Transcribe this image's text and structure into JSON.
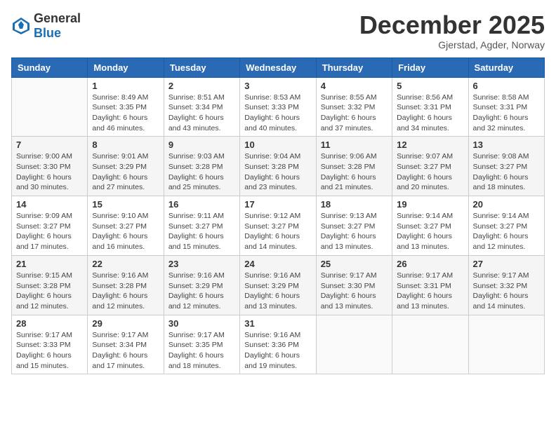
{
  "logo": {
    "text_general": "General",
    "text_blue": "Blue"
  },
  "header": {
    "month": "December 2025",
    "location": "Gjerstad, Agder, Norway"
  },
  "days_of_week": [
    "Sunday",
    "Monday",
    "Tuesday",
    "Wednesday",
    "Thursday",
    "Friday",
    "Saturday"
  ],
  "weeks": [
    [
      {
        "day": "",
        "sunrise": "",
        "sunset": "",
        "daylight": ""
      },
      {
        "day": "1",
        "sunrise": "Sunrise: 8:49 AM",
        "sunset": "Sunset: 3:35 PM",
        "daylight": "Daylight: 6 hours and 46 minutes."
      },
      {
        "day": "2",
        "sunrise": "Sunrise: 8:51 AM",
        "sunset": "Sunset: 3:34 PM",
        "daylight": "Daylight: 6 hours and 43 minutes."
      },
      {
        "day": "3",
        "sunrise": "Sunrise: 8:53 AM",
        "sunset": "Sunset: 3:33 PM",
        "daylight": "Daylight: 6 hours and 40 minutes."
      },
      {
        "day": "4",
        "sunrise": "Sunrise: 8:55 AM",
        "sunset": "Sunset: 3:32 PM",
        "daylight": "Daylight: 6 hours and 37 minutes."
      },
      {
        "day": "5",
        "sunrise": "Sunrise: 8:56 AM",
        "sunset": "Sunset: 3:31 PM",
        "daylight": "Daylight: 6 hours and 34 minutes."
      },
      {
        "day": "6",
        "sunrise": "Sunrise: 8:58 AM",
        "sunset": "Sunset: 3:31 PM",
        "daylight": "Daylight: 6 hours and 32 minutes."
      }
    ],
    [
      {
        "day": "7",
        "sunrise": "Sunrise: 9:00 AM",
        "sunset": "Sunset: 3:30 PM",
        "daylight": "Daylight: 6 hours and 30 minutes."
      },
      {
        "day": "8",
        "sunrise": "Sunrise: 9:01 AM",
        "sunset": "Sunset: 3:29 PM",
        "daylight": "Daylight: 6 hours and 27 minutes."
      },
      {
        "day": "9",
        "sunrise": "Sunrise: 9:03 AM",
        "sunset": "Sunset: 3:28 PM",
        "daylight": "Daylight: 6 hours and 25 minutes."
      },
      {
        "day": "10",
        "sunrise": "Sunrise: 9:04 AM",
        "sunset": "Sunset: 3:28 PM",
        "daylight": "Daylight: 6 hours and 23 minutes."
      },
      {
        "day": "11",
        "sunrise": "Sunrise: 9:06 AM",
        "sunset": "Sunset: 3:28 PM",
        "daylight": "Daylight: 6 hours and 21 minutes."
      },
      {
        "day": "12",
        "sunrise": "Sunrise: 9:07 AM",
        "sunset": "Sunset: 3:27 PM",
        "daylight": "Daylight: 6 hours and 20 minutes."
      },
      {
        "day": "13",
        "sunrise": "Sunrise: 9:08 AM",
        "sunset": "Sunset: 3:27 PM",
        "daylight": "Daylight: 6 hours and 18 minutes."
      }
    ],
    [
      {
        "day": "14",
        "sunrise": "Sunrise: 9:09 AM",
        "sunset": "Sunset: 3:27 PM",
        "daylight": "Daylight: 6 hours and 17 minutes."
      },
      {
        "day": "15",
        "sunrise": "Sunrise: 9:10 AM",
        "sunset": "Sunset: 3:27 PM",
        "daylight": "Daylight: 6 hours and 16 minutes."
      },
      {
        "day": "16",
        "sunrise": "Sunrise: 9:11 AM",
        "sunset": "Sunset: 3:27 PM",
        "daylight": "Daylight: 6 hours and 15 minutes."
      },
      {
        "day": "17",
        "sunrise": "Sunrise: 9:12 AM",
        "sunset": "Sunset: 3:27 PM",
        "daylight": "Daylight: 6 hours and 14 minutes."
      },
      {
        "day": "18",
        "sunrise": "Sunrise: 9:13 AM",
        "sunset": "Sunset: 3:27 PM",
        "daylight": "Daylight: 6 hours and 13 minutes."
      },
      {
        "day": "19",
        "sunrise": "Sunrise: 9:14 AM",
        "sunset": "Sunset: 3:27 PM",
        "daylight": "Daylight: 6 hours and 13 minutes."
      },
      {
        "day": "20",
        "sunrise": "Sunrise: 9:14 AM",
        "sunset": "Sunset: 3:27 PM",
        "daylight": "Daylight: 6 hours and 12 minutes."
      }
    ],
    [
      {
        "day": "21",
        "sunrise": "Sunrise: 9:15 AM",
        "sunset": "Sunset: 3:28 PM",
        "daylight": "Daylight: 6 hours and 12 minutes."
      },
      {
        "day": "22",
        "sunrise": "Sunrise: 9:16 AM",
        "sunset": "Sunset: 3:28 PM",
        "daylight": "Daylight: 6 hours and 12 minutes."
      },
      {
        "day": "23",
        "sunrise": "Sunrise: 9:16 AM",
        "sunset": "Sunset: 3:29 PM",
        "daylight": "Daylight: 6 hours and 12 minutes."
      },
      {
        "day": "24",
        "sunrise": "Sunrise: 9:16 AM",
        "sunset": "Sunset: 3:29 PM",
        "daylight": "Daylight: 6 hours and 13 minutes."
      },
      {
        "day": "25",
        "sunrise": "Sunrise: 9:17 AM",
        "sunset": "Sunset: 3:30 PM",
        "daylight": "Daylight: 6 hours and 13 minutes."
      },
      {
        "day": "26",
        "sunrise": "Sunrise: 9:17 AM",
        "sunset": "Sunset: 3:31 PM",
        "daylight": "Daylight: 6 hours and 13 minutes."
      },
      {
        "day": "27",
        "sunrise": "Sunrise: 9:17 AM",
        "sunset": "Sunset: 3:32 PM",
        "daylight": "Daylight: 6 hours and 14 minutes."
      }
    ],
    [
      {
        "day": "28",
        "sunrise": "Sunrise: 9:17 AM",
        "sunset": "Sunset: 3:33 PM",
        "daylight": "Daylight: 6 hours and 15 minutes."
      },
      {
        "day": "29",
        "sunrise": "Sunrise: 9:17 AM",
        "sunset": "Sunset: 3:34 PM",
        "daylight": "Daylight: 6 hours and 17 minutes."
      },
      {
        "day": "30",
        "sunrise": "Sunrise: 9:17 AM",
        "sunset": "Sunset: 3:35 PM",
        "daylight": "Daylight: 6 hours and 18 minutes."
      },
      {
        "day": "31",
        "sunrise": "Sunrise: 9:16 AM",
        "sunset": "Sunset: 3:36 PM",
        "daylight": "Daylight: 6 hours and 19 minutes."
      },
      {
        "day": "",
        "sunrise": "",
        "sunset": "",
        "daylight": ""
      },
      {
        "day": "",
        "sunrise": "",
        "sunset": "",
        "daylight": ""
      },
      {
        "day": "",
        "sunrise": "",
        "sunset": "",
        "daylight": ""
      }
    ]
  ]
}
